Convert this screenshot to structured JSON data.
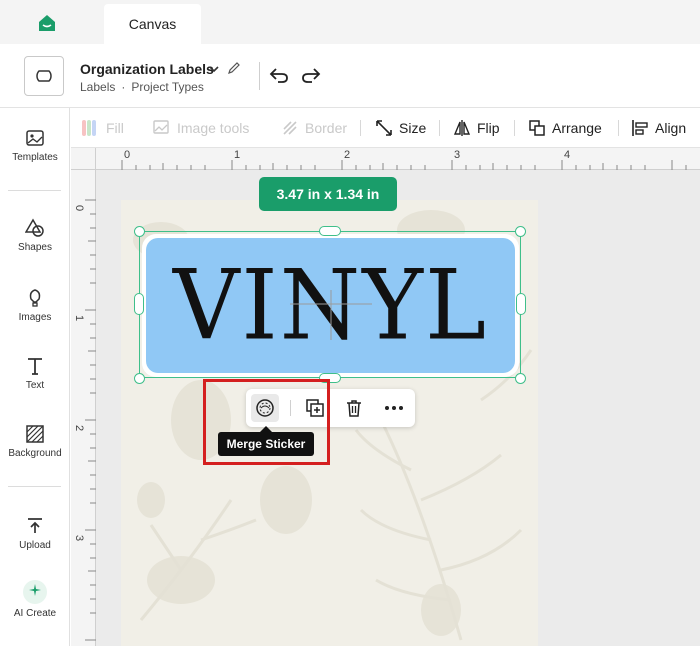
{
  "tabs": {
    "canvas": "Canvas"
  },
  "project": {
    "title": "Organization Labels",
    "category": "Labels",
    "separator": "·",
    "type": "Project Types"
  },
  "sidebar": {
    "items": [
      {
        "label": "Templates",
        "icon": "templates-icon"
      },
      {
        "label": "Shapes",
        "icon": "shapes-icon"
      },
      {
        "label": "Images",
        "icon": "images-icon"
      },
      {
        "label": "Text",
        "icon": "text-icon"
      },
      {
        "label": "Background",
        "icon": "background-icon"
      },
      {
        "label": "Upload",
        "icon": "upload-icon"
      },
      {
        "label": "AI Create",
        "icon": "ai-create-icon"
      }
    ]
  },
  "toolbar": {
    "fill": "Fill",
    "image_tools": "Image tools",
    "border": "Border",
    "size": "Size",
    "flip": "Flip",
    "arrange": "Arrange",
    "align": "Align"
  },
  "ruler": {
    "top": [
      "0",
      "1",
      "2",
      "3",
      "4"
    ],
    "left": [
      "0",
      "1",
      "2",
      "3"
    ]
  },
  "canvas": {
    "dimensions": "3.47  in x 1.34  in",
    "sticker_text": "VINYL",
    "sticker_color": "#90c8f5",
    "selection_color": "#3fbf8a"
  },
  "context_menu": {
    "tooltip": "Merge Sticker",
    "buttons": [
      "merge-sticker-icon",
      "duplicate-icon",
      "trash-icon",
      "more-icon"
    ]
  },
  "colors": {
    "brand": "#1a9d6a",
    "highlight": "#d41f1f"
  }
}
